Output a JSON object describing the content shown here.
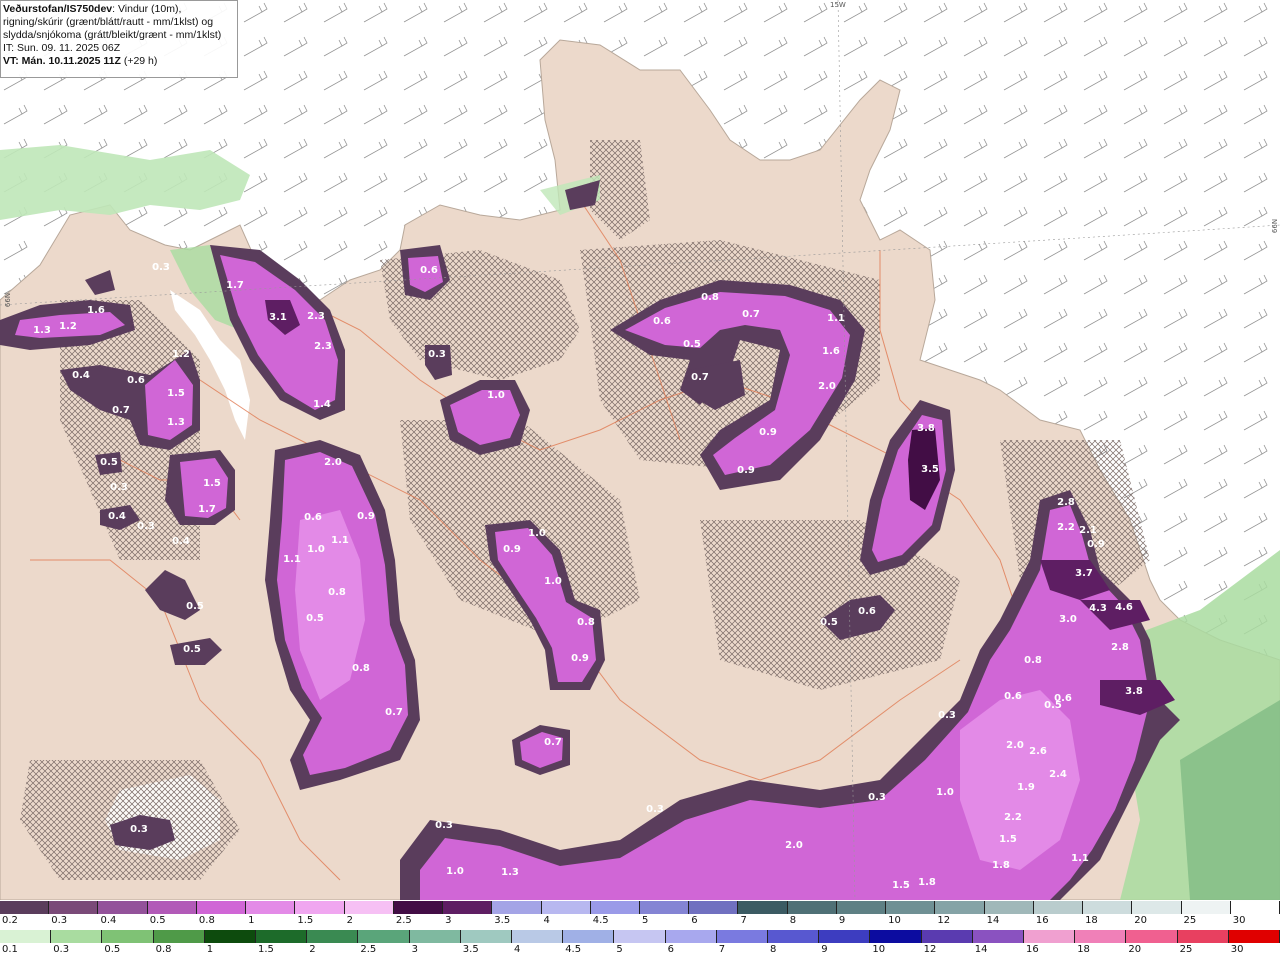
{
  "header": {
    "title_bold": "Veðurstofan/IS750dev",
    "title_rest": ": Vindur (10m),",
    "line2": "rigning/skúrir (grænt/blátt/rautt - mm/1klst) og",
    "line3": "slydda/snjókoma (grátt/bleikt/grænt - mm/1klst)",
    "line4": "IT: Sun. 09. 11. 2025 06Z",
    "line5_bold": "VT: Mán. 10.11.2025 11Z",
    "line5_rest": " (+29 h)"
  },
  "axis_labels": {
    "top": "15W",
    "left": "66N",
    "right": "66N"
  },
  "legend_snow": {
    "labels": [
      "0.2",
      "0.3",
      "0.4",
      "0.5",
      "0.8",
      "1",
      "1.5",
      "2",
      "2.5",
      "3",
      "3.5",
      "4",
      "4.5",
      "5",
      "6",
      "7",
      "8",
      "9",
      "10",
      "12",
      "14",
      "16",
      "18",
      "20",
      "25",
      "30"
    ],
    "colors": [
      "#5a3d5c",
      "#7a4a78",
      "#93529a",
      "#b25ab8",
      "#d066d6",
      "#e38ae7",
      "#f0a6f0",
      "#f6c0f4",
      "#420d45",
      "#5e1e63",
      "#a4a4e6",
      "#b8b8f0",
      "#9a9ae8",
      "#8484d4",
      "#7070c0",
      "#3b5b63",
      "#4f7076",
      "#5e8084",
      "#6f9094",
      "#85a3a6",
      "#a0b8b9",
      "#b9cccd",
      "#cddcdd",
      "#dde8e8",
      "#eef3f3",
      "#ffffff"
    ]
  },
  "legend_rain": {
    "labels": [
      "0.1",
      "0.3",
      "0.5",
      "0.8",
      "1",
      "1.5",
      "2",
      "2.5",
      "3",
      "3.5",
      "4",
      "4.5",
      "5",
      "6",
      "7",
      "8",
      "9",
      "10",
      "12",
      "14",
      "16",
      "18",
      "20",
      "25",
      "30"
    ],
    "colors": [
      "#d9f2d4",
      "#a9dca0",
      "#7fc275",
      "#4f9a48",
      "#0d4b0d",
      "#1d6b2a",
      "#3a8a52",
      "#5aa57a",
      "#7fb9a0",
      "#9fc9c0",
      "#b9c9e6",
      "#a0b0e6",
      "#c6c6f2",
      "#a8a8ee",
      "#7a7ae0",
      "#5858d0",
      "#3d3dc0",
      "#0c0ca0",
      "#5a3bb0",
      "#8a52c0",
      "#f0a0d0",
      "#f080b8",
      "#f06090",
      "#e84060",
      "#e00000"
    ]
  },
  "map_values": [
    {
      "v": "0.3"
    },
    {
      "v": "1.3"
    },
    {
      "v": "1.2"
    },
    {
      "v": "1.6"
    },
    {
      "v": "0.3"
    },
    {
      "v": "1.7"
    },
    {
      "v": "3.1"
    },
    {
      "v": "2.3"
    },
    {
      "v": "2.3"
    },
    {
      "v": "1.4"
    },
    {
      "v": "0.6"
    },
    {
      "v": "0.3"
    },
    {
      "v": "1.0"
    },
    {
      "v": "0.8"
    },
    {
      "v": "0.7"
    },
    {
      "v": "0.6"
    },
    {
      "v": "0.5"
    },
    {
      "v": "1.1"
    },
    {
      "v": "1.6"
    },
    {
      "v": "2.0"
    },
    {
      "v": "0.7"
    },
    {
      "v": "0.9"
    },
    {
      "v": "0.9"
    },
    {
      "v": "3.8"
    },
    {
      "v": "3.5"
    },
    {
      "v": "1.2"
    },
    {
      "v": "0.4"
    },
    {
      "v": "0.6"
    },
    {
      "v": "0.7"
    },
    {
      "v": "1.5"
    },
    {
      "v": "1.3"
    },
    {
      "v": "0.5"
    },
    {
      "v": "0.3"
    },
    {
      "v": "1.5"
    },
    {
      "v": "1.7"
    },
    {
      "v": "0.4"
    },
    {
      "v": "0.3"
    },
    {
      "v": "0.4"
    },
    {
      "v": "0.5"
    },
    {
      "v": "0.5"
    },
    {
      "v": "2.0"
    },
    {
      "v": "0.6"
    },
    {
      "v": "0.9"
    },
    {
      "v": "1.0"
    },
    {
      "v": "1.1"
    },
    {
      "v": "1.1"
    },
    {
      "v": "0.8"
    },
    {
      "v": "0.5"
    },
    {
      "v": "0.8"
    },
    {
      "v": "0.7"
    },
    {
      "v": "1.0"
    },
    {
      "v": "0.9"
    },
    {
      "v": "1.0"
    },
    {
      "v": "0.8"
    },
    {
      "v": "0.9"
    },
    {
      "v": "0.7"
    },
    {
      "v": "0.5"
    },
    {
      "v": "0.6"
    },
    {
      "v": "2.8"
    },
    {
      "v": "2.2"
    },
    {
      "v": "2.1"
    },
    {
      "v": "3.7"
    },
    {
      "v": "3.0"
    },
    {
      "v": "4.3"
    },
    {
      "v": "4.6"
    },
    {
      "v": "2.8"
    },
    {
      "v": "3.8"
    },
    {
      "v": "0.8"
    },
    {
      "v": "0.6"
    },
    {
      "v": "0.6"
    },
    {
      "v": "2.0"
    },
    {
      "v": "2.6"
    },
    {
      "v": "2.4"
    },
    {
      "v": "1.9"
    },
    {
      "v": "2.2"
    },
    {
      "v": "1.5"
    },
    {
      "v": "1.8"
    },
    {
      "v": "1.1"
    },
    {
      "v": "0.3"
    },
    {
      "v": "0.3"
    },
    {
      "v": "0.3"
    },
    {
      "v": "1.0"
    },
    {
      "v": "1.3"
    },
    {
      "v": "2.0"
    },
    {
      "v": "0.3"
    },
    {
      "v": "1.0"
    },
    {
      "v": "1.5"
    },
    {
      "v": "1.8"
    },
    {
      "v": "0.3"
    },
    {
      "v": "0.5"
    },
    {
      "v": "0.9"
    }
  ]
}
